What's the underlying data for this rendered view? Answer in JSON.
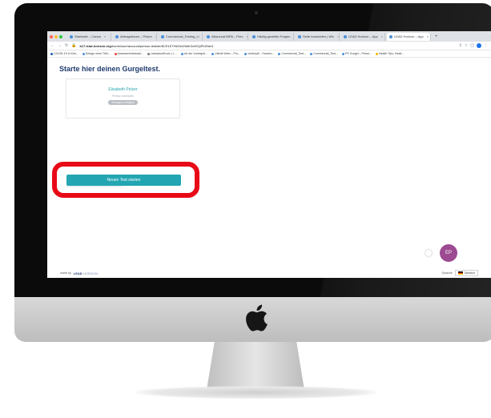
{
  "browser": {
    "tabs": [
      {
        "label": "Startseite – Canva",
        "active": false
      },
      {
        "label": "Abfragebaum – Prisen",
        "active": false
      },
      {
        "label": "Commercial_Testing_Li",
        "active": false
      },
      {
        "label": "Allianzcat BIPA – Prev",
        "active": false
      },
      {
        "label": "Häufig gestellte Fragen",
        "active": false
      },
      {
        "label": "Seite bearbeiten | Wix",
        "active": false
      },
      {
        "label": "LEAD Horizon – App",
        "active": false
      },
      {
        "label": "LEAD Horizon – App",
        "active": true
      }
    ],
    "new_tab_label": "+",
    "url_domain": "b17.lead-horizon.org",
    "url_path": "/home/user/account/person-test/de/6CE1E7H6Ge/ZbbKZc9OQPhZNe/4",
    "bookmarks": [
      "COVID-19 In Kirs...",
      "Design ohne Titel...",
      "Anwesenheitsbald...",
      "LabradorsEvolu | L...",
      "Ad der Vorlesphi...",
      "Uitbuit Wein – Pro...",
      "verlichpft – Facebo...",
      "Commercial_Test...",
      "Commercial_Test...",
      "PS Gurgel – Prese...",
      "Health Tips, Healt..."
    ],
    "traffic_colors": [
      "#ff5f57",
      "#febc2e",
      "#28c840"
    ]
  },
  "page": {
    "title": "Starte hier deinen Gurgeltest.",
    "profile": {
      "name": "Elisabeth Pelzer",
      "subtitle": "Person wechseln",
      "chip": "Testungen verfügbar"
    },
    "start_button_label": "Neuen Test starten",
    "avatar_initials": "EP",
    "footer": {
      "made_by": "made by",
      "brand_main": "LEAD",
      "brand_sub": "HORIZON",
      "language_label": "Sprache",
      "language_value": "Deutsch"
    }
  },
  "colors": {
    "accent": "#23a6b2",
    "title": "#1f3b6e",
    "highlight": "#e80a17",
    "avatar": "#9c4a91"
  }
}
